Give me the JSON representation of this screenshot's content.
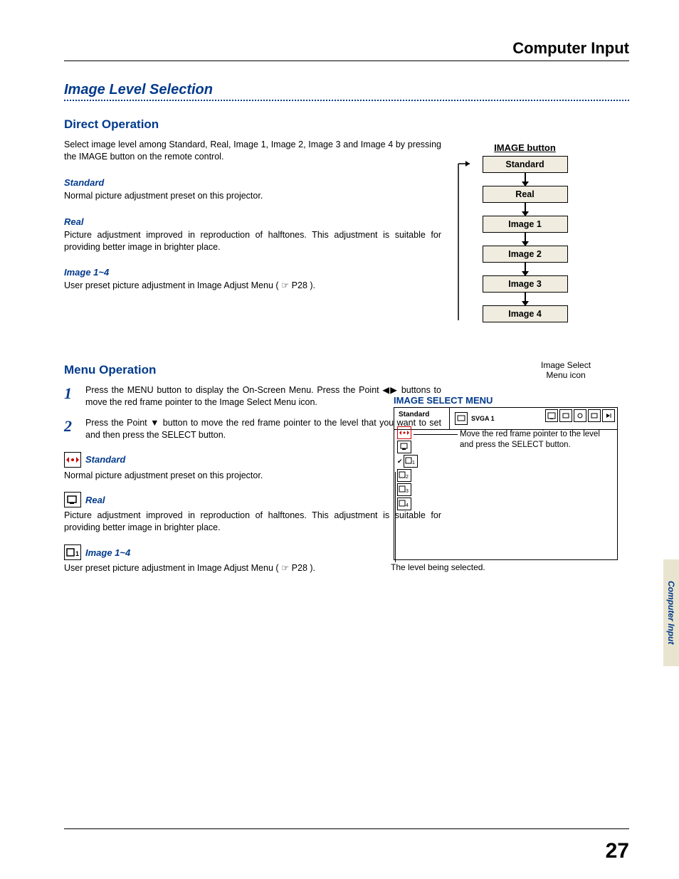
{
  "header": {
    "title": "Computer Input"
  },
  "section_title": "Image Level Selection",
  "direct_op": {
    "heading": "Direct Operation",
    "intro": "Select image level among Standard, Real, Image 1, Image 2, Image 3 and Image 4 by pressing the IMAGE button on the remote control.",
    "standard_h": "Standard",
    "standard_b": "Normal picture adjustment preset on this projector.",
    "real_h": "Real",
    "real_b": "Picture adjustment improved in reproduction of halftones.  This adjustment is suitable for providing better image in brighter place.",
    "img14_h": "Image 1~4",
    "img14_b": "User preset picture adjustment in Image Adjust Menu ( ☞ P28 )."
  },
  "menu_op": {
    "heading": "Menu Operation",
    "step1": "Press the MENU button to display the On-Screen Menu. Press the Point ◀▶ buttons to move the red frame pointer to the Image Select Menu icon.",
    "step2": "Press the Point ▼ button to move the red frame pointer to the level that you want to set and then press the SELECT button.",
    "standard_h": "Standard",
    "standard_b": "Normal picture adjustment preset on this projector.",
    "real_h": "Real",
    "real_b": "Picture adjustment improved in reproduction of halftones.  This adjustment is suitable for providing better image in brighter place.",
    "img14_h": "Image 1~4",
    "img14_b": "User preset picture adjustment in Image Adjust Menu ( ☞ P28 )."
  },
  "flow": {
    "title": "IMAGE button",
    "items": [
      "Standard",
      "Real",
      "Image 1",
      "Image 2",
      "Image 3",
      "Image 4"
    ]
  },
  "ism": {
    "icon_label": "Image Select\nMenu icon",
    "title": "IMAGE SELECT MENU",
    "top_label": "Standard",
    "mid_label": "SVGA 1",
    "note": "Move the red frame pointer to the level and press the SELECT button.",
    "bottom": "The level being selected."
  },
  "side_tab": "Computer Input",
  "page_number": "27"
}
